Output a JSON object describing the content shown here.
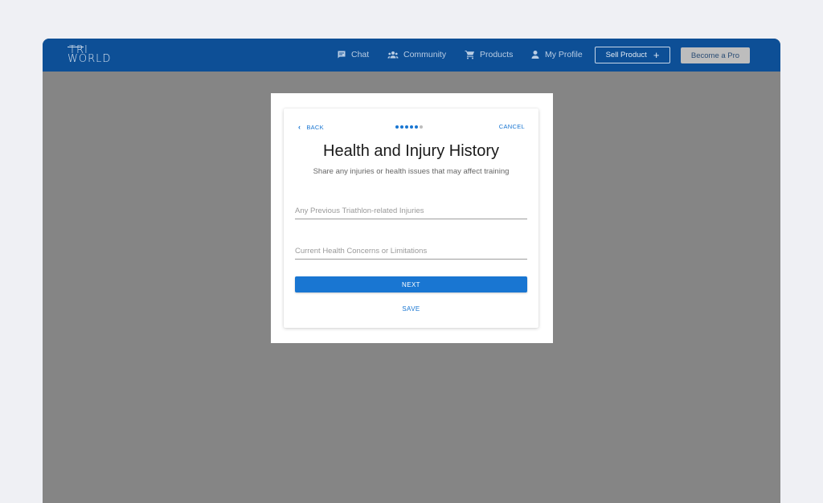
{
  "brand": {
    "line1": "TRI",
    "line2": "WORLD"
  },
  "nav": {
    "items": [
      {
        "label": "Chat",
        "icon": "chat-icon"
      },
      {
        "label": "Community",
        "icon": "community-icon"
      },
      {
        "label": "Products",
        "icon": "cart-icon"
      },
      {
        "label": "My Profile",
        "icon": "person-icon"
      }
    ],
    "sell_label": "Sell Product",
    "sell_icon": "+",
    "pro_label": "Become a Pro"
  },
  "modal": {
    "back_label": "BACK",
    "cancel_label": "CANCEL",
    "steps_total": 6,
    "steps_done": 5,
    "title": "Health and Injury History",
    "subtitle": "Share any injuries or health issues that may affect training",
    "fields": [
      {
        "placeholder": "Any Previous Triathlon-related Injuries",
        "value": ""
      },
      {
        "placeholder": "Current Health Concerns or Limitations",
        "value": ""
      }
    ],
    "next_label": "NEXT",
    "save_label": "SAVE"
  },
  "colors": {
    "navbar": "#0d4f96",
    "accent": "#1976d2",
    "overlay": "#858585",
    "page_bg": "#eff0f4"
  }
}
